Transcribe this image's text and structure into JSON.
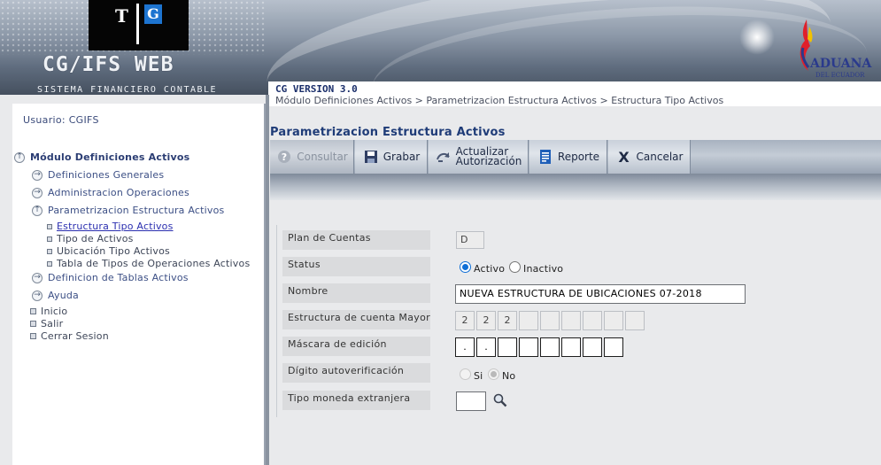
{
  "header": {
    "logo_letter_t": "T",
    "logo_letter_g": "G",
    "app_name": "CG/IFS WEB",
    "app_subtitle": "SISTEMA FINANCIERO CONTABLE",
    "brand_name": "ADUANA",
    "brand_sub": "DEL ECUADOR",
    "version": "CG VERSION 3.0",
    "breadcrumb": "Módulo Definiciones Activos > Parametrizacion Estructura Activos > Estructura Tipo Activos"
  },
  "sidebar": {
    "user": "Usuario: CGIFS",
    "module": "Módulo Definiciones Activos",
    "items": [
      {
        "label": "Definiciones Generales"
      },
      {
        "label": "Administracion Operaciones"
      },
      {
        "label": "Parametrizacion Estructura Activos"
      },
      {
        "label": "Definicion de Tablas Activos"
      },
      {
        "label": "Ayuda"
      }
    ],
    "subitems": [
      {
        "label": "Estructura Tipo Activos"
      },
      {
        "label": "Tipo de Activos"
      },
      {
        "label": "Ubicación Tipo Activos"
      },
      {
        "label": "Tabla de Tipos de Operaciones Activos"
      }
    ],
    "top_items": [
      {
        "label": "Inicio"
      },
      {
        "label": "Salir"
      },
      {
        "label": "Cerrar Sesion"
      }
    ]
  },
  "main": {
    "title": "Parametrizacion Estructura Activos",
    "toolbar": {
      "consultar": "Consultar",
      "grabar": "Grabar",
      "actualizar_line1": "Actualizar",
      "actualizar_line2": "Autorización",
      "reporte": "Reporte",
      "cancelar": "Cancelar"
    },
    "form": {
      "plan_label": "Plan de Cuentas",
      "plan_value": "D",
      "status_label": "Status",
      "status_activo": "Activo",
      "status_inactivo": "Inactivo",
      "status_selected": "Activo",
      "nombre_label": "Nombre",
      "nombre_value": "NUEVA ESTRUCTURA DE UBICACIONES 07-2018",
      "estructura_label": "Estructura de cuenta Mayor",
      "estructura_cells": [
        "2",
        "2",
        "2",
        "",
        "",
        "",
        "",
        "",
        ""
      ],
      "mascara_label": "Máscara de edición",
      "mascara_cells": [
        ".",
        ".",
        "",
        "",
        "",
        "",
        "",
        ""
      ],
      "digito_label": "Dígito autoverificación",
      "digito_si": "Si",
      "digito_no": "No",
      "digito_selected": "No",
      "moneda_label": "Tipo moneda extranjera",
      "moneda_value": ""
    }
  },
  "colors": {
    "accent": "#1f3c78",
    "link_active": "#2b2fb0",
    "radio": "#0f6fd6"
  }
}
